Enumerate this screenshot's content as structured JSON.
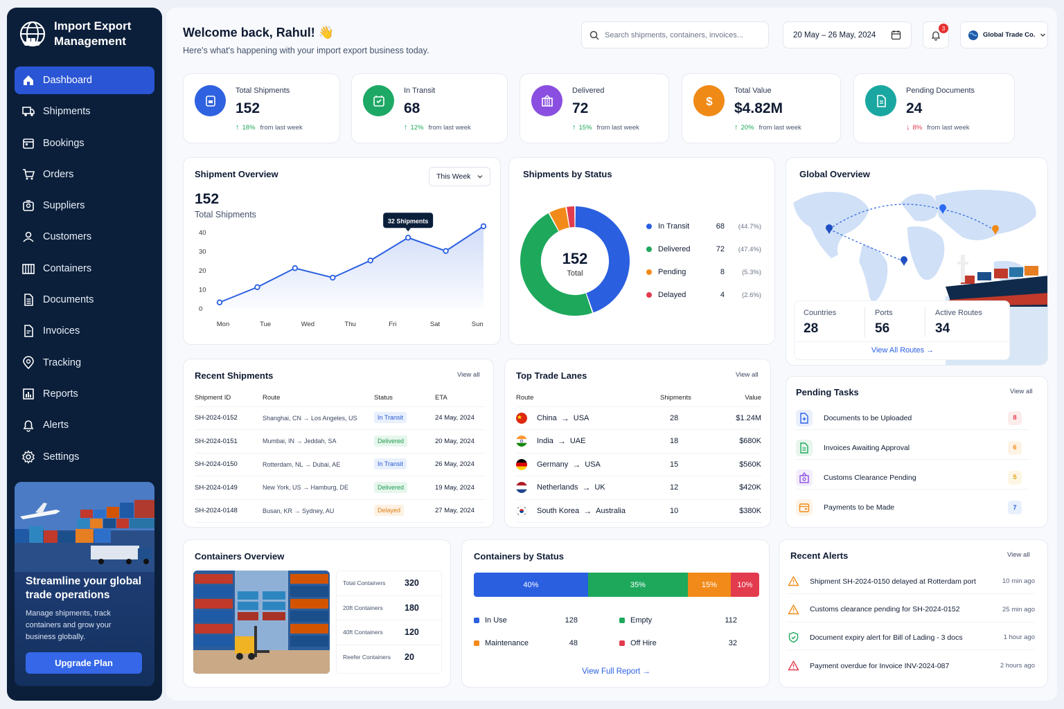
{
  "brand": {
    "title_line1": "Import Export",
    "title_line2": "Management"
  },
  "nav": [
    {
      "label": "Dashboard",
      "icon": "home-icon"
    },
    {
      "label": "Shipments",
      "icon": "truck-icon"
    },
    {
      "label": "Bookings",
      "icon": "calendar-icon"
    },
    {
      "label": "Orders",
      "icon": "cart-icon"
    },
    {
      "label": "Suppliers",
      "icon": "supplier-icon"
    },
    {
      "label": "Customers",
      "icon": "user-icon"
    },
    {
      "label": "Containers",
      "icon": "container-icon"
    },
    {
      "label": "Documents",
      "icon": "document-icon"
    },
    {
      "label": "Invoices",
      "icon": "invoice-icon"
    },
    {
      "label": "Tracking",
      "icon": "location-icon"
    },
    {
      "label": "Reports",
      "icon": "reports-icon"
    },
    {
      "label": "Alerts",
      "icon": "bell-icon"
    },
    {
      "label": "Settings",
      "icon": "gear-icon"
    }
  ],
  "promo": {
    "title": "Streamline your global trade operations",
    "desc": "Manage shipments, track containers and grow your business globally.",
    "button": "Upgrade Plan"
  },
  "header": {
    "welcome": "Welcome back, Rahul! 👋",
    "subtitle": "Here's what's happening with your import export business today.",
    "search_placeholder": "Search shipments, containers, invoices...",
    "date_range": "20 May – 26 May, 2024",
    "notifications": "3",
    "company": "Global Trade Co."
  },
  "kpis": [
    {
      "label": "Total Shipments",
      "value": "152",
      "trend": "18%",
      "trend_text": "from last week",
      "dir": "up",
      "color": "#2f62e0"
    },
    {
      "label": "In Transit",
      "value": "68",
      "trend": "12%",
      "trend_text": "from last week",
      "dir": "up",
      "color": "#1ea866"
    },
    {
      "label": "Delivered",
      "value": "72",
      "trend": "15%",
      "trend_text": "from last week",
      "dir": "up",
      "color": "#8a4fe0"
    },
    {
      "label": "Total Value",
      "value": "$4.82M",
      "trend": "20%",
      "trend_text": "from last week",
      "dir": "up",
      "color": "#f08a17"
    },
    {
      "label": "Pending Documents",
      "value": "24",
      "trend": "8%",
      "trend_text": "from last week",
      "dir": "down",
      "color": "#1aa7a1"
    }
  ],
  "shipment_overview": {
    "title": "Shipment Overview",
    "period": "This Week",
    "total": "152",
    "total_label": "Total Shipments",
    "tooltip": "32 Shipments"
  },
  "chart_data": {
    "type": "line",
    "categories": [
      "Mon",
      "Tue",
      "Wed",
      "Thu",
      "Fri",
      "Sat",
      "Sun"
    ],
    "values": [
      3,
      11,
      21,
      16,
      25,
      37,
      30,
      43
    ],
    "x": [
      "Mon",
      "",
      "Tue",
      "",
      "Wed",
      "",
      "Thu",
      "",
      "Fri",
      "",
      "Sat",
      "",
      "Sun"
    ],
    "points": [
      3,
      11,
      21,
      16,
      25,
      37,
      30,
      43
    ],
    "yticks": [
      40,
      30,
      20,
      10,
      0
    ],
    "ylim": [
      0,
      40
    ]
  },
  "status_chart": {
    "title": "Shipments by Status",
    "total": "152",
    "total_label": "Total",
    "items": [
      {
        "label": "In Transit",
        "count": "68",
        "pct": "(44.7%)",
        "value": 44.7,
        "color": "#2a5fe0"
      },
      {
        "label": "Delivered",
        "count": "72",
        "pct": "(47.4%)",
        "value": 47.4,
        "color": "#1ea85c"
      },
      {
        "label": "Pending",
        "count": "8",
        "pct": "(5.3%)",
        "value": 5.3,
        "color": "#f28a1a"
      },
      {
        "label": "Delayed",
        "count": "4",
        "pct": "(2.6%)",
        "value": 2.6,
        "color": "#e23b4d"
      }
    ]
  },
  "global": {
    "title": "Global Overview",
    "countries_label": "Countries",
    "countries": "28",
    "ports_label": "Ports",
    "ports": "56",
    "routes_label": "Active Routes",
    "routes": "34",
    "link": "View All Routes"
  },
  "recent_shipments": {
    "title": "Recent Shipments",
    "view_all": "View all",
    "headers": [
      "Shipment ID",
      "Route",
      "Status",
      "ETA"
    ],
    "rows": [
      {
        "id": "SH-2024-0152",
        "route": "Shanghai, CN → Los Angeles, US",
        "status": "In Transit",
        "eta": "24 May, 2024",
        "cls": "st-transit"
      },
      {
        "id": "SH-2024-0151",
        "route": "Mumbai, IN → Jeddah, SA",
        "status": "Delivered",
        "eta": "20 May, 2024",
        "cls": "st-delivered"
      },
      {
        "id": "SH-2024-0150",
        "route": "Rotterdam, NL → Dubai, AE",
        "status": "In Transit",
        "eta": "26 May, 2024",
        "cls": "st-transit"
      },
      {
        "id": "SH-2024-0149",
        "route": "New York, US → Hamburg, DE",
        "status": "Delivered",
        "eta": "19 May, 2024",
        "cls": "st-delivered"
      },
      {
        "id": "SH-2024-0148",
        "route": "Busan, KR → Sydney, AU",
        "status": "Delayed",
        "eta": "27 May, 2024",
        "cls": "st-delayed"
      }
    ]
  },
  "trade_lanes": {
    "title": "Top Trade Lanes",
    "view_all": "View all",
    "headers": [
      "Route",
      "Shipments",
      "Value"
    ],
    "rows": [
      {
        "from": "China",
        "to": "USA",
        "shipments": "28",
        "value": "$1.24M",
        "flag": "cn"
      },
      {
        "from": "India",
        "to": "UAE",
        "shipments": "18",
        "value": "$680K",
        "flag": "in"
      },
      {
        "from": "Germany",
        "to": "USA",
        "shipments": "15",
        "value": "$560K",
        "flag": "de"
      },
      {
        "from": "Netherlands",
        "to": "UK",
        "shipments": "12",
        "value": "$420K",
        "flag": "nl"
      },
      {
        "from": "South Korea",
        "to": "Australia",
        "shipments": "10",
        "value": "$380K",
        "flag": "kr"
      }
    ]
  },
  "pending_tasks": {
    "title": "Pending Tasks",
    "view_all": "View all",
    "items": [
      {
        "label": "Documents to be Uploaded",
        "count": "8",
        "color": "#2a5fe0",
        "badge_bg": "#fdecec",
        "badge_fg": "#e23b4d"
      },
      {
        "label": "Invoices Awaiting Approval",
        "count": "6",
        "color": "#1ea85c",
        "badge_bg": "#fef3e4",
        "badge_fg": "#f08a17"
      },
      {
        "label": "Customs Clearance Pending",
        "count": "5",
        "color": "#8a4fe0",
        "badge_bg": "#fef6e4",
        "badge_fg": "#e0a315"
      },
      {
        "label": "Payments to be Made",
        "count": "7",
        "color": "#f08a17",
        "badge_bg": "#e8f0fd",
        "badge_fg": "#2a5fe0"
      }
    ]
  },
  "containers": {
    "title": "Containers Overview",
    "stats": [
      {
        "label": "Total Containers",
        "value": "320"
      },
      {
        "label": "20ft Containers",
        "value": "180"
      },
      {
        "label": "40ft Containers",
        "value": "120"
      },
      {
        "label": "Reefer Containers",
        "value": "20"
      }
    ]
  },
  "containers_status": {
    "title": "Containers by Status",
    "bars": [
      {
        "pct": "40%",
        "value": 40,
        "color": "#2a5fe0"
      },
      {
        "pct": "35%",
        "value": 35,
        "color": "#1ea85c"
      },
      {
        "pct": "15%",
        "value": 15,
        "color": "#f28a1a"
      },
      {
        "pct": "10%",
        "value": 10,
        "color": "#e23b4d"
      }
    ],
    "legend": [
      {
        "label": "In Use",
        "value": "128",
        "color": "#2a5fe0"
      },
      {
        "label": "Empty",
        "value": "112",
        "color": "#1ea85c"
      },
      {
        "label": "Maintenance",
        "value": "48",
        "color": "#f28a1a"
      },
      {
        "label": "Off Hire",
        "value": "32",
        "color": "#e23b4d"
      }
    ],
    "link": "View Full Report"
  },
  "alerts": {
    "title": "Recent Alerts",
    "view_all": "View all",
    "items": [
      {
        "text": "Shipment SH-2024-0150 delayed at Rotterdam port",
        "time": "10 min ago",
        "color": "#f08a17"
      },
      {
        "text": "Customs clearance pending for SH-2024-0152",
        "time": "25 min ago",
        "color": "#f08a17"
      },
      {
        "text": "Document expiry alert for Bill of Lading - 3 docs",
        "time": "1 hour ago",
        "color": "#1ea85c"
      },
      {
        "text": "Payment overdue for Invoice INV-2024-087",
        "time": "2 hours ago",
        "color": "#e23b4d"
      }
    ]
  }
}
